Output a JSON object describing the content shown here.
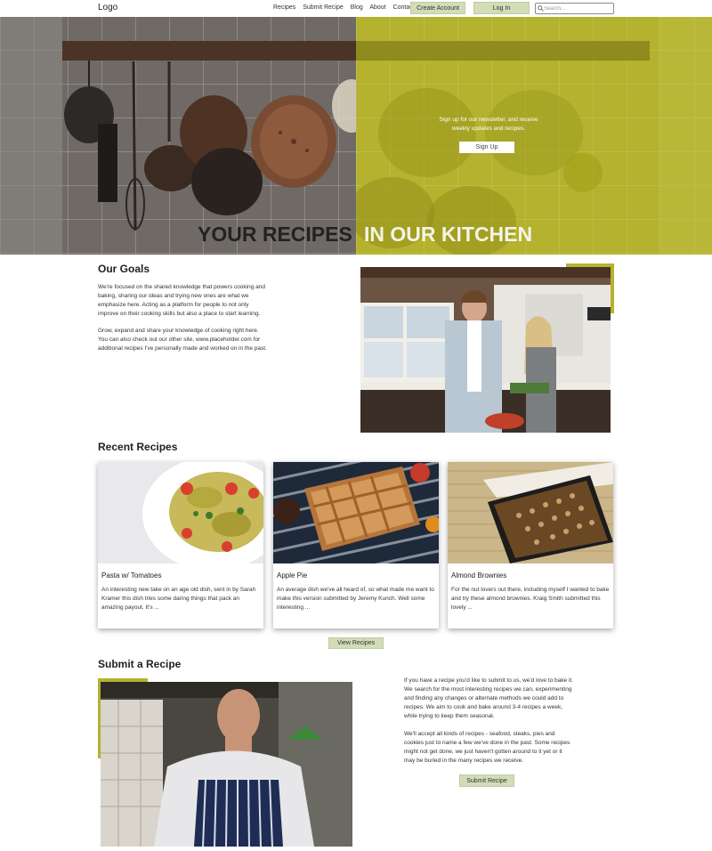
{
  "nav": {
    "logo": "Logo",
    "links": [
      "Recipes",
      "Submit Recipe",
      "Blog",
      "About",
      "Contact"
    ],
    "create_account": "Create Account",
    "login": "Log In",
    "search_placeholder": "Search..."
  },
  "hero": {
    "newsletter_text": "Sign up for our newsletter, and receive weekly updates and recipes.",
    "signup_label": "Sign Up",
    "title_left": "YOUR RECIPES",
    "title_right": "IN OUR KITCHEN"
  },
  "goals": {
    "title": "Our Goals",
    "para1": "We're focused on the shared knowledge that powers cooking and baking, sharing our ideas and trying new ones are what we emphasize here. Acting as a platform for people to not only improve on their cooking skills but also a place to start learning.",
    "para2": "Grow, expand and share your knowledge of cooking right here. You can also check out our other site, www.placeholder.com for additional recipes I've personally made and worked on in the past."
  },
  "recipes": {
    "title": "Recent Recipes",
    "cards": [
      {
        "title": "Pasta w/ Tomatoes",
        "desc": "An interesting new take on an age old dish, sent in by Sarah Kramer this dish tries some daring things that pack an amazing payout. It's ..."
      },
      {
        "title": "Apple Pie",
        "desc": "An average dish we've all heard of, so what made me want to make this version submitted by Jeremy Kunch. Well some interesting ..."
      },
      {
        "title": "Almond Brownies",
        "desc": "For the nut lovers out there, including myself I wanted to bake and try these almond brownies. Kraig Smith submitted this lovely ..."
      }
    ],
    "view_label": "View Recipes"
  },
  "submit": {
    "title": "Submit a Recipe",
    "para1": "If you have a recipe you'd like to submit to us, we'd love to bake it. We search for the most interesting recipes we can, experimenting and finding any changes or alternate methods we could add to recipes. We aim to cook and bake around 3-4 recipes a week, while trying to keep them seasonal.",
    "para2": "We'll accept all kinds of recipes - seafood, steaks, pies and cookies just to name a few we've done in the past. Some recipes might not get done, we just haven't gotten around to it yet or it may be buried in the many recipes we receive.",
    "button_label": "Submit Recipe"
  },
  "colors": {
    "accent": "#b4b22e",
    "button": "#d2dcb6"
  }
}
